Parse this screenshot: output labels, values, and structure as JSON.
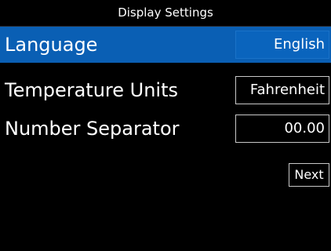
{
  "header": {
    "title": "Display Settings"
  },
  "settings": [
    {
      "label": "Language",
      "value": "English",
      "selected": true
    },
    {
      "label": "Temperature Units",
      "value": "Fahrenheit",
      "selected": false
    },
    {
      "label": "Number Separator",
      "value": "00.00",
      "selected": false
    }
  ],
  "actions": {
    "next_label": "Next"
  },
  "colors": {
    "background": "#000000",
    "selected_row": "#0a5fb4",
    "text": "#ffffff",
    "border": "#c8c8c8"
  }
}
